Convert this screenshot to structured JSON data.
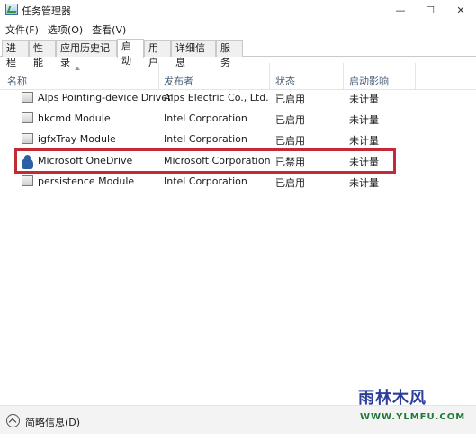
{
  "window": {
    "title": "任务管理器",
    "minimize_glyph": "—",
    "maximize_glyph": "☐",
    "close_glyph": "✕"
  },
  "menu": [
    "文件(F)",
    "选项(O)",
    "查看(V)"
  ],
  "tabs": [
    "进程",
    "性能",
    "应用历史记录",
    "启动",
    "用户",
    "详细信息",
    "服务"
  ],
  "active_tab": "启动",
  "columns": {
    "name": "名称",
    "publisher": "发布者",
    "status": "状态",
    "impact": "启动影响"
  },
  "rows": [
    {
      "icon": "device-driver-icon",
      "name": "Alps Pointing-device Driver",
      "publisher": "Alps Electric Co., Ltd.",
      "status": "已启用",
      "impact": "未计量"
    },
    {
      "icon": "module-icon",
      "name": "hkcmd Module",
      "publisher": "Intel Corporation",
      "status": "已启用",
      "impact": "未计量"
    },
    {
      "icon": "module-icon",
      "name": "igfxTray Module",
      "publisher": "Intel Corporation",
      "status": "已启用",
      "impact": "未计量"
    },
    {
      "icon": "onedrive-cloud-icon",
      "name": "Microsoft OneDrive",
      "publisher": "Microsoft Corporation",
      "status": "已禁用",
      "impact": "未计量"
    },
    {
      "icon": "module-icon",
      "name": "persistence Module",
      "publisher": "Intel Corporation",
      "status": "已启用",
      "impact": "未计量"
    }
  ],
  "highlight_color": "#c32a36",
  "footer": {
    "label": "简略信息(D)"
  },
  "watermark": {
    "main": "雨林木风",
    "sub": "WWW.YLMFU.COM"
  }
}
